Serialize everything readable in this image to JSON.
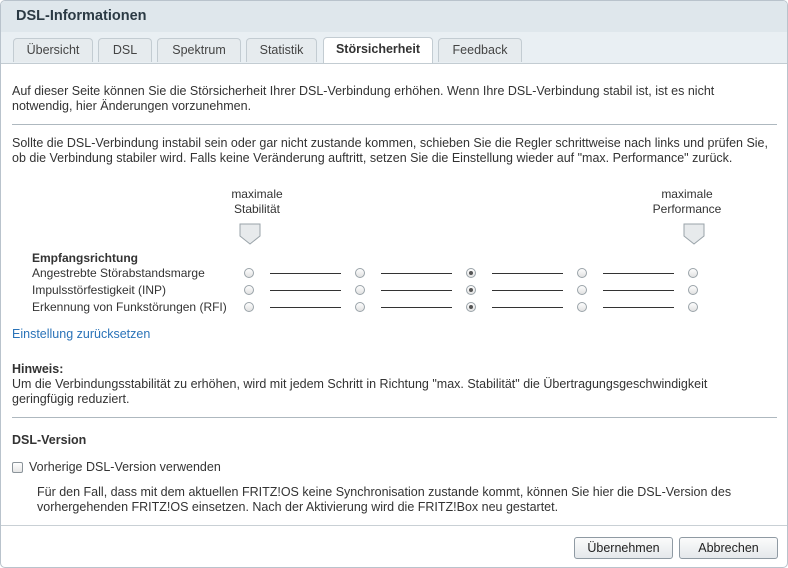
{
  "window": {
    "title": "DSL-Informationen"
  },
  "tabs": [
    {
      "label": "Übersicht"
    },
    {
      "label": "DSL"
    },
    {
      "label": "Spektrum"
    },
    {
      "label": "Statistik"
    },
    {
      "label": "Störsicherheit"
    },
    {
      "label": "Feedback"
    }
  ],
  "active_tab": "Störsicherheit",
  "intro_text": "Auf dieser Seite können Sie die Störsicherheit Ihrer DSL-Verbindung erhöhen. Wenn Ihre DSL-Verbindung stabil ist, ist es nicht notwendig, hier Änderungen vorzunehmen.",
  "instruction_text": "Sollte die DSL-Verbindung instabil sein oder gar nicht zustande kommen, schieben Sie die Regler schrittweise nach links und prüfen Sie, ob die Verbindung stabiler wird. Falls keine Veränderung auftritt, setzen Sie die Einstellung wieder auf \"max. Performance\" zurück.",
  "scale": {
    "left_label_line1": "maximale",
    "left_label_line2": "Stabilität",
    "right_label_line1": "maximale",
    "right_label_line2": "Performance"
  },
  "section_heading": "Empfangsrichtung",
  "settings": [
    {
      "label": "Angestrebte Störabstandsmarge",
      "selected_step": 3,
      "steps": 5
    },
    {
      "label": "Impulsstörfestigkeit (INP)",
      "selected_step": 3,
      "steps": 5
    },
    {
      "label": "Erkennung von Funkstörungen (RFI)",
      "selected_step": 3,
      "steps": 5
    }
  ],
  "reset_link": "Einstellung zurücksetzen",
  "hint": {
    "title": "Hinweis:",
    "text": "Um die Verbindungsstabilität zu erhöhen, wird mit jedem Schritt in Richtung \"max. Stabilität\" die Übertragungsgeschwindigkeit geringfügig reduziert."
  },
  "dsl_version": {
    "heading": "DSL-Version",
    "checkbox_label": "Vorherige DSL-Version verwenden",
    "checked": false,
    "description": "Für den Fall, dass mit dem aktuellen FRITZ!OS keine Synchronisation zustande kommt, können Sie hier die DSL-Version des vorhergehenden FRITZ!OS einsetzen. Nach der Aktivierung wird die FRITZ!Box neu gestartet."
  },
  "buttons": {
    "apply": "Übernehmen",
    "cancel": "Abbrechen"
  }
}
